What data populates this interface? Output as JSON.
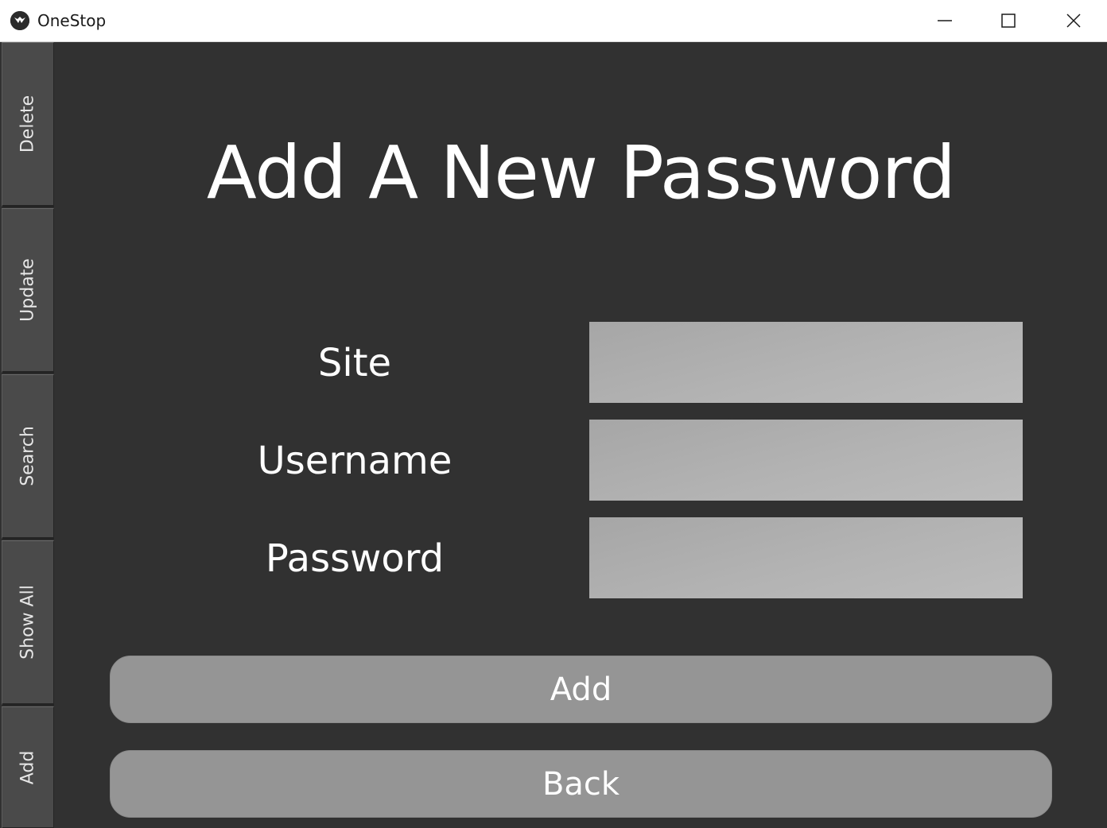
{
  "window": {
    "title": "OneStop",
    "app_icon": "kivy-logo-icon",
    "controls": [
      "minimize-icon",
      "maximize-icon",
      "close-icon"
    ]
  },
  "sidebar": {
    "tabs": [
      {
        "label": "Delete"
      },
      {
        "label": "Update"
      },
      {
        "label": "Search"
      },
      {
        "label": "Show All"
      },
      {
        "label": "Add"
      }
    ]
  },
  "main": {
    "title": "Add A New Password",
    "fields": [
      {
        "label": "Site",
        "value": "",
        "placeholder": ""
      },
      {
        "label": "Username",
        "value": "",
        "placeholder": ""
      },
      {
        "label": "Password",
        "value": "",
        "placeholder": ""
      }
    ],
    "buttons": {
      "add_label": "Add",
      "back_label": "Back"
    }
  },
  "colors": {
    "background": "#313131",
    "sidebar_tab": "#4a4a4a",
    "input_fill": "#b0b0b0",
    "button_fill": "#959595",
    "text": "#ffffff"
  }
}
